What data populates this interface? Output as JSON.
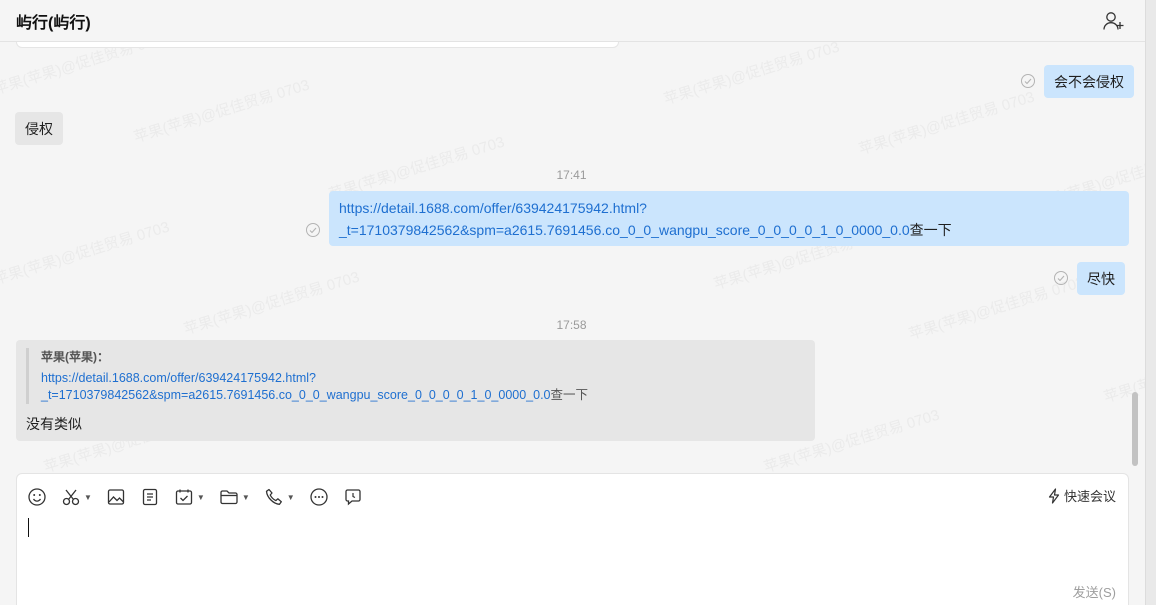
{
  "header": {
    "title": "屿行(屿行)",
    "add_user_icon": "add-user-icon"
  },
  "watermark_text": "苹果(苹果)@促佳贸易 0703",
  "messages": {
    "m1": {
      "text": "会不会侵权"
    },
    "m2": {
      "text": "侵权"
    },
    "time1": "17:41",
    "m3": {
      "link_line1": "https://detail.1688.com/offer/639424175942.html?",
      "link_line2": "_t=1710379842562&spm=a2615.7691456.co_0_0_wangpu_score_0_0_0_0_1_0_0000_0.0",
      "suffix": "查一下"
    },
    "m4": {
      "text": "尽快"
    },
    "time2": "17:58",
    "m5": {
      "quote_author": "苹果(苹果)：",
      "quote_link_line1": "https://detail.1688.com/offer/639424175942.html?",
      "quote_link_line2": "_t=1710379842562&spm=a2615.7691456.co_0_0_wangpu_score_0_0_0_0_1_0_0000_0.0",
      "quote_suffix": "查一下",
      "reply": "没有类似"
    }
  },
  "toolbar": {
    "icons": [
      "emoji-icon",
      "scissors-icon",
      "image-icon",
      "document-icon",
      "calendar-check-icon",
      "folder-icon",
      "phone-icon",
      "more-icon",
      "chat-bubble-icon"
    ],
    "quick_meeting_label": "快速会议"
  },
  "send_label": "发送(S)",
  "colors": {
    "sent_bubble": "#cbe5fd",
    "received_bubble": "#e6e6e6",
    "link": "#1e6fd0"
  }
}
